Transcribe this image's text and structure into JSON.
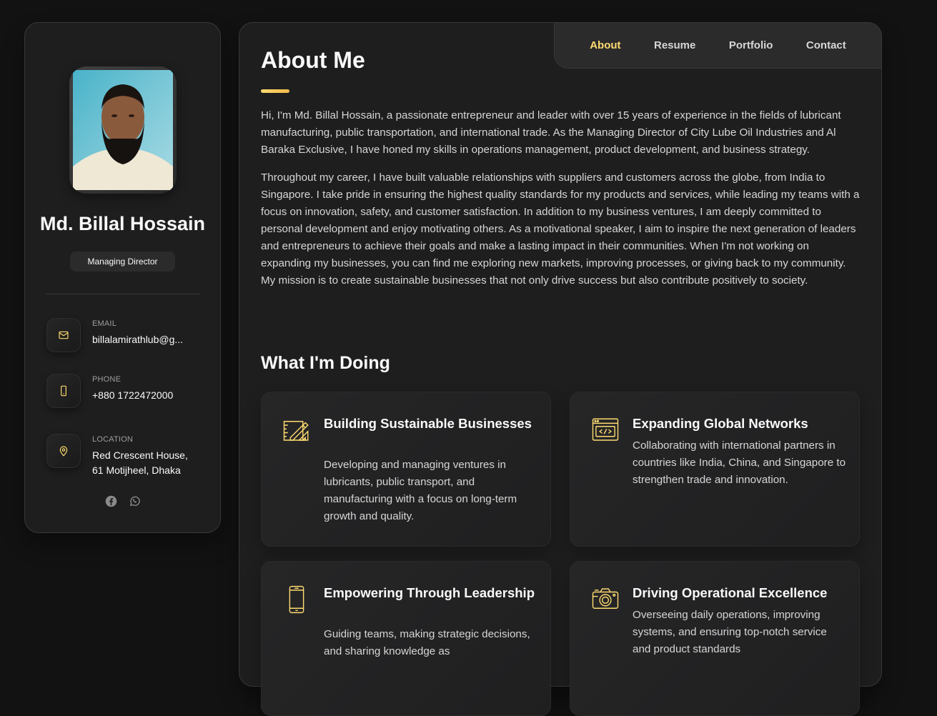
{
  "profile": {
    "name": "Md. Billal Hossain",
    "title": "Managing Director"
  },
  "contacts": [
    {
      "label": "Email",
      "value": "billalamirathlub@g...",
      "icon": "mail-icon"
    },
    {
      "label": "Phone",
      "value": "+880 1722472000",
      "icon": "phone-icon"
    },
    {
      "label": "Location",
      "value": "Red Crescent House, 61 Motijheel, Dhaka",
      "icon": "location-pin-icon"
    }
  ],
  "socials": [
    "facebook-icon",
    "whatsapp-icon"
  ],
  "nav": {
    "items": [
      "About",
      "Resume",
      "Portfolio",
      "Contact"
    ],
    "active": "About"
  },
  "about": {
    "heading": "About Me",
    "paragraphs": [
      "Hi, I'm Md. Billal Hossain, a passionate entrepreneur and leader with over 15 years of experience in the fields of lubricant manufacturing, public transportation, and international trade. As the Managing Director of City Lube Oil Industries and Al Baraka Exclusive, I have honed my skills in operations management, product development, and business strategy.",
      "Throughout my career, I have built valuable relationships with suppliers and customers across the globe, from India to Singapore. I take pride in ensuring the highest quality standards for my products and services, while leading my teams with a focus on innovation, safety, and customer satisfaction. In addition to my business ventures, I am deeply committed to personal development and enjoy motivating others. As a motivational speaker, I aim to inspire the next generation of leaders and entrepreneurs to achieve their goals and make a lasting impact in their communities. When I'm not working on expanding my businesses, you can find me exploring new markets, improving processes, or giving back to my community. My mission is to create sustainable businesses that not only drive success but also contribute positively to society."
    ]
  },
  "services": {
    "heading": "What I'm Doing",
    "items": [
      {
        "title": "Building Sustainable Businesses",
        "text": "Developing and managing ventures in lubricants, public transport, and manufacturing with a focus on long-term growth and quality.",
        "icon": "design-tools-icon"
      },
      {
        "title": "Expanding Global Networks",
        "text": "Collaborating with international partners in countries like India, China, and Singapore to strengthen trade and innovation.",
        "icon": "code-window-icon"
      },
      {
        "title": "Empowering Through Leadership",
        "text": "Guiding teams, making strategic decisions, and sharing knowledge as",
        "icon": "smartphone-icon"
      },
      {
        "title": "Driving Operational Excellence",
        "text": "Overseeing daily operations, improving systems, and ensuring top-notch service and product standards",
        "icon": "camera-icon"
      }
    ]
  },
  "colors": {
    "accent": "#ffdb70",
    "background": "#121212",
    "card": "#1e1e1f"
  }
}
